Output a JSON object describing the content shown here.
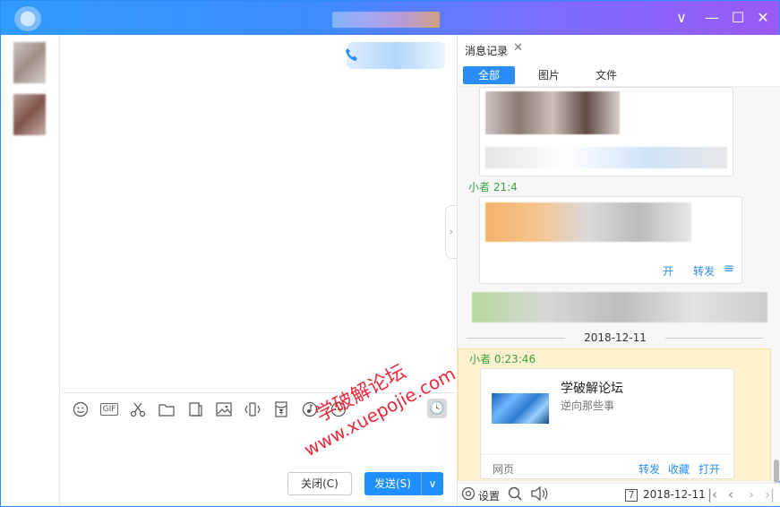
{
  "window": {
    "minimize_glyph": "—",
    "restore_glyph": "☐",
    "close_glyph": "✕",
    "collapse_glyph": "∨"
  },
  "toolbar": {
    "gif_label": "GIF",
    "history_glyph": "🕓"
  },
  "actions": {
    "close_label": "关闭(C)",
    "send_label": "发送(S)",
    "send_arrow": "∨"
  },
  "history_panel": {
    "tab_title": "消息记录",
    "tab_close_glyph": "✕",
    "filters": [
      "全部",
      "图片",
      "文件"
    ],
    "entries": {
      "sender_1_partial": "小者 21:4",
      "card1_actions": [
        "开",
        "转发"
      ],
      "date_separator": "2018-12-11",
      "highlight_sender": "小者 0:23:46",
      "link_card": {
        "title": "学破解论坛",
        "subtitle": "逆向那些事",
        "source": "网页",
        "actions": [
          "转发",
          "收藏",
          "打开"
        ]
      }
    },
    "bottom_bar": {
      "settings_label": "设置",
      "date_value": "2018-12-11",
      "calendar_day": "7"
    }
  },
  "watermark": {
    "line1": "学破解论坛",
    "line2": "www.xuepojie.com"
  },
  "colors": {
    "accent": "#2a8df5",
    "sender_green": "#3aa142",
    "highlight_bg": "#fdf1cf",
    "watermark_red": "#e8192c"
  }
}
